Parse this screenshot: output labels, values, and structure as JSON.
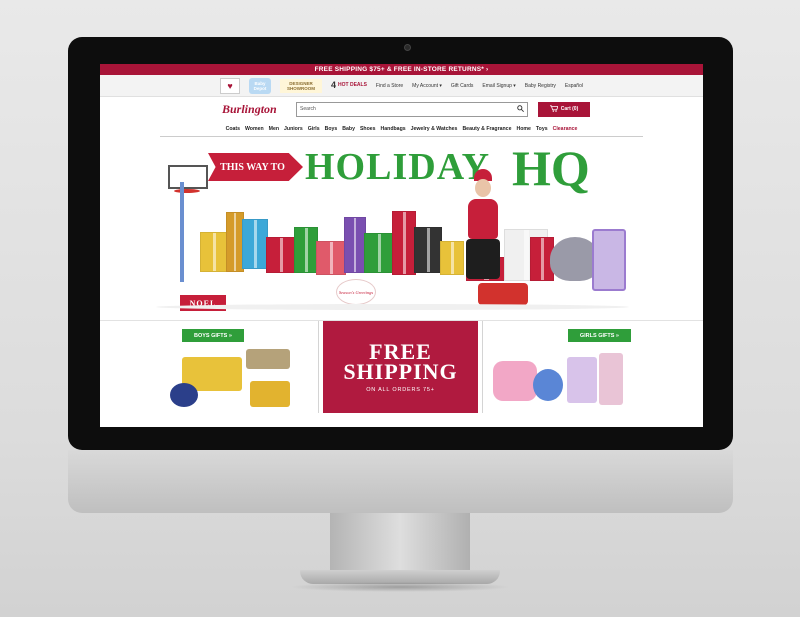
{
  "colors": {
    "brand": "#a81438",
    "green": "#2f9e3a",
    "panel_red": "#b01a3f"
  },
  "promo_bar": {
    "text": "FREE SHIPPING $75+ & FREE IN-STORE RETURNS* ›"
  },
  "utility_nav": {
    "heart_icon": "heart-icon",
    "baby_depot": "Baby Depot",
    "designer_showroom": "DESIGNER SHOWROOM",
    "hot_deals_num": "4",
    "hot_deals": "HOT DEALS",
    "links": [
      "Find a Store",
      "My Account ▾",
      "Gift Cards",
      "Email Signup ▾",
      "Baby Registry",
      "Español"
    ]
  },
  "header": {
    "logo": "Burlington",
    "search_placeholder": "Search",
    "cart_label": "Cart (0)"
  },
  "main_nav": {
    "items": [
      "Coats",
      "Women",
      "Men",
      "Juniors",
      "Girls",
      "Boys",
      "Baby",
      "Shoes",
      "Handbags",
      "Jewelry & Watches",
      "Beauty & Fragrance",
      "Home",
      "Toys"
    ],
    "clearance": "Clearance"
  },
  "hero": {
    "sign": "THIS WAY TO",
    "holiday": "HOLIDAY",
    "hq": "HQ",
    "noel": "NOEL",
    "season": "Season's Greetings"
  },
  "panels": {
    "boys_gifts": "BOYS GIFTS »",
    "free_line1": "FREE",
    "free_line2": "SHIPPING",
    "free_sub": "ON ALL ORDERS 75+",
    "girls_gifts": "GIRLS GIFTS »"
  }
}
